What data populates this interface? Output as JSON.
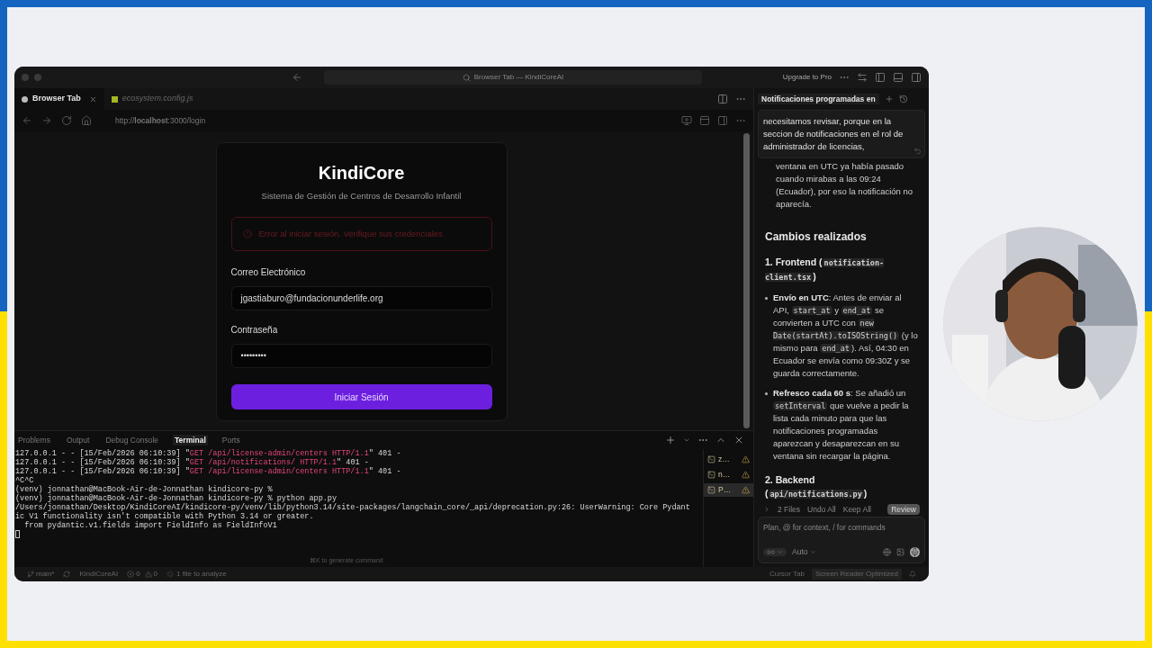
{
  "window": {
    "search": "Browser Tab — KindiCoreAI",
    "upgrade": "Upgrade to Pro"
  },
  "editor_tabs": [
    {
      "label": "Browser Tab",
      "selected": true,
      "kind": "browser"
    },
    {
      "label": "ecosystem.config.js",
      "selected": false,
      "kind": "js"
    }
  ],
  "browser": {
    "url": "http://**localhost**:3000/login"
  },
  "login": {
    "title": "KindiCore",
    "subtitle": "Sistema de Gestión de Centros de Desarrollo Infantil",
    "error": "Error al iniciar sesión. Verifique sus credenciales",
    "email_label": "Correo Electrónico",
    "email": "jgastiaburo@fundacionunderlife.org",
    "password_label": "Contraseña",
    "password": "•••••••••",
    "button": "Iniciar Sesión"
  },
  "panel": {
    "tabs": [
      {
        "label": "Problems",
        "selected": false
      },
      {
        "label": "Output",
        "selected": false
      },
      {
        "label": "Debug Console",
        "selected": false
      },
      {
        "label": "Terminal",
        "selected": true
      },
      {
        "label": "Ports",
        "selected": false
      }
    ],
    "lines": [
      [
        {
          "kind": "plain",
          "text": "127.0.0.1 - - [15/Feb/2026 06:10:39] \""
        },
        {
          "kind": "request",
          "text": "GET /api/license-admin/centers HTTP/1.1"
        },
        {
          "kind": "plain",
          "text": "\" 401 -"
        }
      ],
      [
        {
          "kind": "plain",
          "text": "127.0.0.1 - - [15/Feb/2026 06:10:39] \""
        },
        {
          "kind": "request",
          "text": "GET /api/notifications/ HTTP/1.1"
        },
        {
          "kind": "plain",
          "text": "\" 401 -"
        }
      ],
      [
        {
          "kind": "plain",
          "text": "127.0.0.1 - - [15/Feb/2026 06:10:39] \""
        },
        {
          "kind": "request",
          "text": "GET /api/license-admin/centers HTTP/1.1"
        },
        {
          "kind": "plain",
          "text": "\" 401 -"
        }
      ],
      [
        {
          "kind": "plain",
          "text": "^C^C"
        }
      ],
      [
        {
          "kind": "plain",
          "text": "(venv) jonnathan@MacBook-Air-de-Jonnathan kindicore-py %"
        }
      ],
      [
        {
          "kind": "plain",
          "text": "(venv) jonnathan@MacBook-Air-de-Jonnathan kindicore-py % python app.py"
        }
      ],
      [
        {
          "kind": "plain",
          "text": "/Users/jonnathan/Desktop/KindiCoreAI/kindicore-py/venv/lib/python3.14/site-packages/langchain_core/_api/deprecation.py:26: UserWarning: Core Pydant"
        }
      ],
      [
        {
          "kind": "plain",
          "text": "ic V1 functionality isn't compatible with Python 3.14 or greater."
        }
      ],
      [
        {
          "kind": "plain",
          "text": "  from pydantic.v1.fields import FieldInfo as FieldInfoV1"
        }
      ]
    ],
    "hint": "⌘K to generate command",
    "terminals": [
      {
        "label": "z…",
        "selected": false
      },
      {
        "label": "n…",
        "selected": false
      },
      {
        "label": "P…",
        "selected": true
      }
    ]
  },
  "chat": {
    "title": "Notificaciones programadas en",
    "message": "necesitamos revisar, porque en la seccion de notificaciones en el rol de administrador de licencias,",
    "blocks": [
      {
        "kind": "continuation",
        "parts": [
          {
            "kind": "text",
            "text": "ventana en UTC ya había pasado cuando mirabas a las 09:24 (Ecuador), por eso la notificación no aparecía."
          }
        ]
      },
      {
        "kind": "heading",
        "parts": [
          {
            "kind": "text",
            "text": "Cambios realizados"
          }
        ]
      },
      {
        "kind": "subheading",
        "parts": [
          {
            "kind": "text",
            "text": "1. Frontend ("
          },
          {
            "kind": "code",
            "text": "notification-client.tsx"
          },
          {
            "kind": "text",
            "text": ")"
          }
        ]
      },
      {
        "kind": "bullet",
        "parts": [
          {
            "kind": "bold",
            "text": "Envío en UTC"
          },
          {
            "kind": "text",
            "text": ": Antes de enviar al API, "
          },
          {
            "kind": "code",
            "text": "start_at"
          },
          {
            "kind": "text",
            "text": " y "
          },
          {
            "kind": "code",
            "text": "end_at"
          },
          {
            "kind": "text",
            "text": " se convierten a UTC con "
          },
          {
            "kind": "code",
            "text": "new Date(startAt).toISOString()"
          },
          {
            "kind": "text",
            "text": " (y lo mismo para "
          },
          {
            "kind": "code",
            "text": "end_at"
          },
          {
            "kind": "text",
            "text": "). Así, 04:30 en Ecuador se envía como 09:30Z y se guarda correctamente."
          }
        ]
      },
      {
        "kind": "bullet",
        "parts": [
          {
            "kind": "bold",
            "text": "Refresco cada 60 s"
          },
          {
            "kind": "text",
            "text": ": Se añadió un "
          },
          {
            "kind": "code",
            "text": "setInterval"
          },
          {
            "kind": "text",
            "text": " que vuelve a pedir la lista cada minuto para que las notificaciones programadas aparezcan y desaparezcan en su ventana sin recargar la página."
          }
        ]
      },
      {
        "kind": "subheading",
        "parts": [
          {
            "kind": "text",
            "text": "2. Backend ("
          },
          {
            "kind": "code",
            "text": "api/notifications.py"
          },
          {
            "kind": "text",
            "text": ")"
          }
        ]
      }
    ],
    "files": "2 Files",
    "undo": "Undo All",
    "keep": "Keep All",
    "review": "Review",
    "placeholder": "Plan, @ for context, / for commands",
    "model": "Auto"
  },
  "status_bar": {
    "branch": "main*",
    "project": "KindiCoreAI",
    "errors": "0",
    "warnings": "0",
    "analyze": "1 file to analyze",
    "right": [
      "Cursor Tab",
      "Screen Reader Optimized"
    ]
  }
}
